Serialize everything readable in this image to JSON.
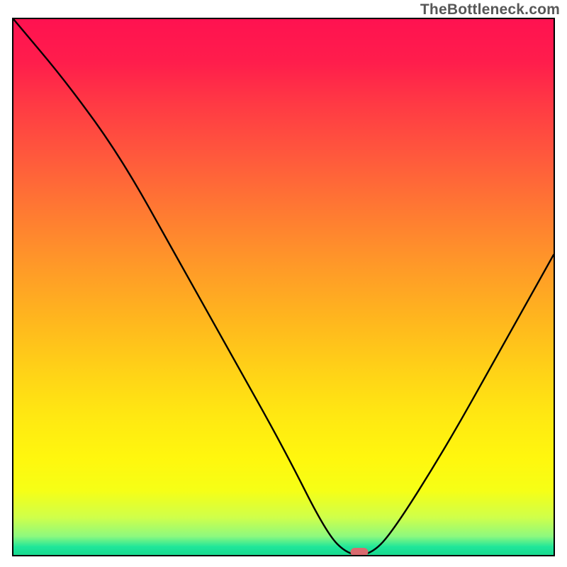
{
  "attribution": "TheBottleneck.com",
  "chart_data": {
    "type": "line",
    "title": "",
    "xlabel": "",
    "ylabel": "",
    "xlim": [
      0,
      100
    ],
    "ylim": [
      0,
      100
    ],
    "series": [
      {
        "name": "bottleneck-curve",
        "x": [
          0,
          10,
          20,
          30,
          40,
          50,
          58,
          62,
          66,
          70,
          80,
          90,
          100
        ],
        "y": [
          100,
          88,
          74,
          56,
          38,
          20,
          4,
          0,
          0,
          4,
          20,
          38,
          56
        ]
      }
    ],
    "marker": {
      "x": 64,
      "y": 0.5
    },
    "gradient_stops": [
      {
        "pos": 0,
        "color": "#ff1250"
      },
      {
        "pos": 8,
        "color": "#ff1d4c"
      },
      {
        "pos": 16,
        "color": "#ff3a44"
      },
      {
        "pos": 26,
        "color": "#ff5a3c"
      },
      {
        "pos": 36,
        "color": "#ff7a32"
      },
      {
        "pos": 46,
        "color": "#ff9928"
      },
      {
        "pos": 56,
        "color": "#ffb61e"
      },
      {
        "pos": 66,
        "color": "#ffd317"
      },
      {
        "pos": 74,
        "color": "#ffe812"
      },
      {
        "pos": 82,
        "color": "#fff70e"
      },
      {
        "pos": 88,
        "color": "#f6ff16"
      },
      {
        "pos": 93,
        "color": "#cfff4a"
      },
      {
        "pos": 96.5,
        "color": "#8ef97e"
      },
      {
        "pos": 98.5,
        "color": "#1fe69a"
      },
      {
        "pos": 100,
        "color": "#18d98f"
      }
    ]
  }
}
